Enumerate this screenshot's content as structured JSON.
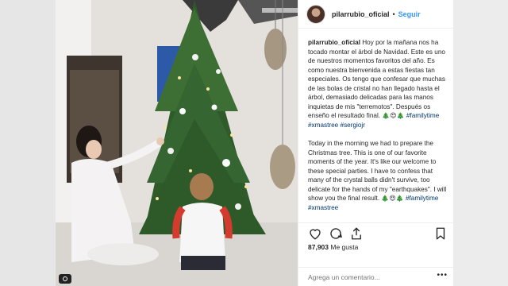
{
  "post": {
    "username": "pilarrubio_oficial",
    "follow_label": "Seguir",
    "separator": "•"
  },
  "caption": {
    "username": "pilarrubio_oficial",
    "spanish_text": "Hoy por la mañana nos ha tocado montar el árbol de Navidad. Este es uno de nuestros momentos favoritos del año. Es como nuestra bienvenida a estas fiestas tan especiales. Os tengo que confesar que muchas de las bolas de cristal no han llegado hasta el árbol, demasiado delicadas para las manos inquietas de mis \"terremotos\". Después os enseño el resultado final.",
    "emojis_1": "🎄😍🎄",
    "hashtag_1": "#familytime",
    "hashtag_2": "#xmastree",
    "hashtag_3": "#sergiojr",
    "english_text": "Today in the morning we had to prepare the Christmas tree. This is one of our favorite moments of the year. It's like our welcome to these special parties. I have to confess that many of the crystal balls didn't survive, too delicate for the hands of my \"earthquakes\". I will show you the final result.",
    "emojis_2": "🎄😍🎄",
    "hashtag_4": "#familytime",
    "hashtag_5": "#xmastree"
  },
  "actions": {
    "like_icon": "heart-icon",
    "comment_icon": "comment-icon",
    "share_icon": "share-icon",
    "save_icon": "bookmark-icon"
  },
  "likes": {
    "count": "87,903",
    "label": "Me gusta"
  },
  "comment": {
    "placeholder": "Agrega un comentario...",
    "more_label": "•••"
  },
  "colors": {
    "link": "#3897f0",
    "hashtag": "#003569",
    "text": "#262626"
  }
}
